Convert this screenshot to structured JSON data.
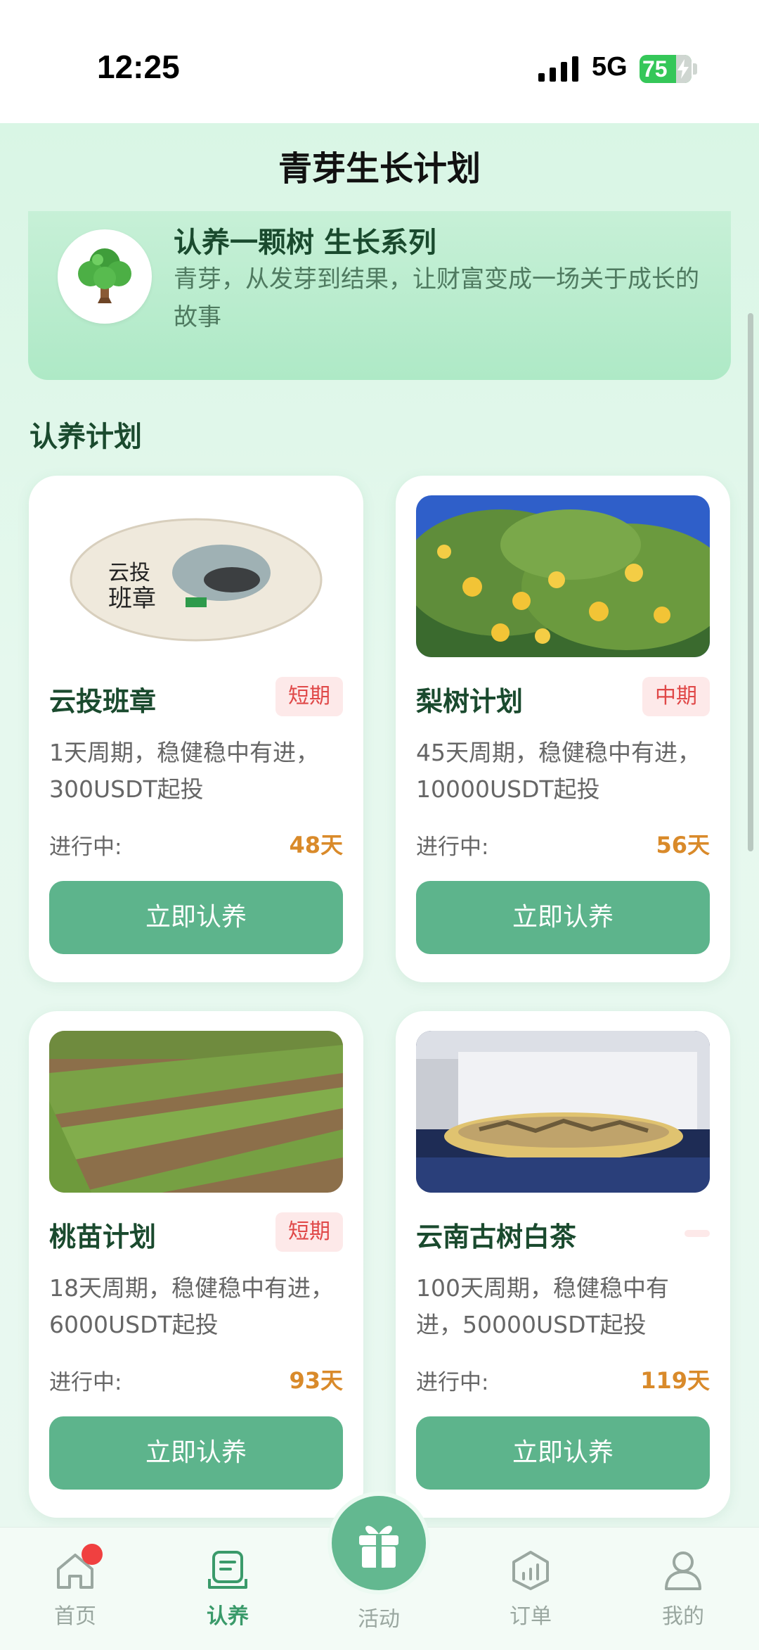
{
  "status_bar": {
    "time": "12:25",
    "network": "5G",
    "battery": "75"
  },
  "page": {
    "title": "青芽生长计划"
  },
  "banner": {
    "title": "认养一颗树 生长系列",
    "description": "青芽，从发芽到结果，让财富变成一场关于成长的故事"
  },
  "section": {
    "title": "认养计划"
  },
  "plans": [
    {
      "name": "云投班章",
      "badge": "短期",
      "desc": "1天周期，稳健稳中有进，300USDT起投",
      "status": "进行中:",
      "days": "48天",
      "button": "立即认养"
    },
    {
      "name": "梨树计划",
      "badge": "中期",
      "desc": "45天周期，稳健稳中有进，10000USDT起投",
      "status": "进行中:",
      "days": "56天",
      "button": "立即认养"
    },
    {
      "name": "桃苗计划",
      "badge": "短期",
      "desc": "18天周期，稳健稳中有进，6000USDT起投",
      "status": "进行中:",
      "days": "93天",
      "button": "立即认养"
    },
    {
      "name": "云南古树白茶",
      "badge": "",
      "desc": "100天周期，稳健稳中有进，50000USDT起投",
      "status": "进行中:",
      "days": "119天",
      "button": "立即认养"
    }
  ],
  "tea_cake_text": {
    "line1": "云投",
    "line2": "班章"
  },
  "nav": [
    {
      "label": "首页",
      "icon": "home-icon",
      "badge_dot": true
    },
    {
      "label": "认养",
      "icon": "adopt-icon",
      "active": true
    },
    {
      "label": "活动",
      "icon": "gift-icon"
    },
    {
      "label": "订单",
      "icon": "order-icon"
    },
    {
      "label": "我的",
      "icon": "profile-icon"
    }
  ],
  "colors": {
    "accent": "#5db48c",
    "badge_bg": "#fde9e9",
    "badge_text": "#e04848",
    "days_text": "#d98a2a",
    "title_green": "#1a4a2e"
  }
}
